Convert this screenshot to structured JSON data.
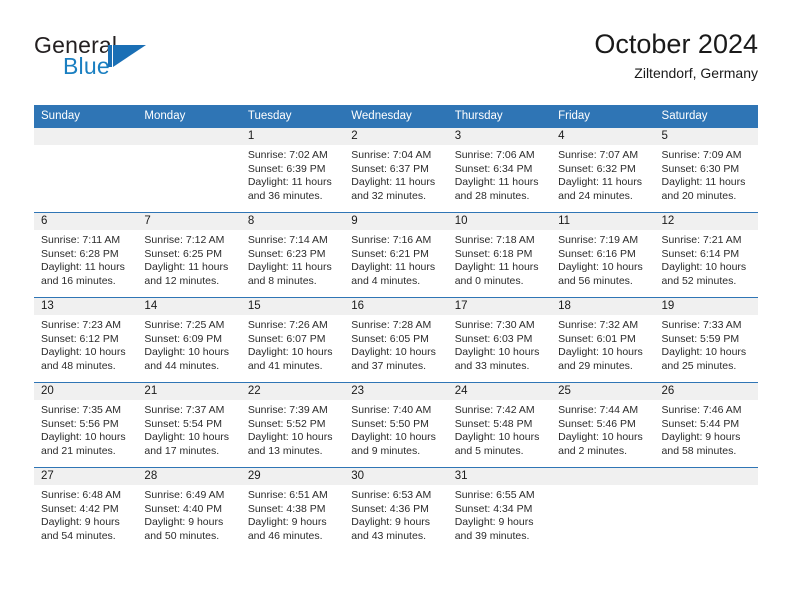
{
  "brand": {
    "name_part1": "General",
    "name_part2": "Blue",
    "accent_color": "#1a7fc1"
  },
  "header": {
    "title": "October 2024",
    "subtitle": "Ziltendorf, Germany"
  },
  "theme": {
    "header_blue": "#2f75b5",
    "daynum_band": "#f0f0f0",
    "text": "#1a1a1a"
  },
  "weekday_headers": [
    "Sunday",
    "Monday",
    "Tuesday",
    "Wednesday",
    "Thursday",
    "Friday",
    "Saturday"
  ],
  "weeks": [
    [
      {
        "day": "",
        "sunrise": "",
        "sunset": "",
        "daylight": ""
      },
      {
        "day": "",
        "sunrise": "",
        "sunset": "",
        "daylight": ""
      },
      {
        "day": "1",
        "sunrise": "Sunrise: 7:02 AM",
        "sunset": "Sunset: 6:39 PM",
        "daylight": "Daylight: 11 hours and 36 minutes."
      },
      {
        "day": "2",
        "sunrise": "Sunrise: 7:04 AM",
        "sunset": "Sunset: 6:37 PM",
        "daylight": "Daylight: 11 hours and 32 minutes."
      },
      {
        "day": "3",
        "sunrise": "Sunrise: 7:06 AM",
        "sunset": "Sunset: 6:34 PM",
        "daylight": "Daylight: 11 hours and 28 minutes."
      },
      {
        "day": "4",
        "sunrise": "Sunrise: 7:07 AM",
        "sunset": "Sunset: 6:32 PM",
        "daylight": "Daylight: 11 hours and 24 minutes."
      },
      {
        "day": "5",
        "sunrise": "Sunrise: 7:09 AM",
        "sunset": "Sunset: 6:30 PM",
        "daylight": "Daylight: 11 hours and 20 minutes."
      }
    ],
    [
      {
        "day": "6",
        "sunrise": "Sunrise: 7:11 AM",
        "sunset": "Sunset: 6:28 PM",
        "daylight": "Daylight: 11 hours and 16 minutes."
      },
      {
        "day": "7",
        "sunrise": "Sunrise: 7:12 AM",
        "sunset": "Sunset: 6:25 PM",
        "daylight": "Daylight: 11 hours and 12 minutes."
      },
      {
        "day": "8",
        "sunrise": "Sunrise: 7:14 AM",
        "sunset": "Sunset: 6:23 PM",
        "daylight": "Daylight: 11 hours and 8 minutes."
      },
      {
        "day": "9",
        "sunrise": "Sunrise: 7:16 AM",
        "sunset": "Sunset: 6:21 PM",
        "daylight": "Daylight: 11 hours and 4 minutes."
      },
      {
        "day": "10",
        "sunrise": "Sunrise: 7:18 AM",
        "sunset": "Sunset: 6:18 PM",
        "daylight": "Daylight: 11 hours and 0 minutes."
      },
      {
        "day": "11",
        "sunrise": "Sunrise: 7:19 AM",
        "sunset": "Sunset: 6:16 PM",
        "daylight": "Daylight: 10 hours and 56 minutes."
      },
      {
        "day": "12",
        "sunrise": "Sunrise: 7:21 AM",
        "sunset": "Sunset: 6:14 PM",
        "daylight": "Daylight: 10 hours and 52 minutes."
      }
    ],
    [
      {
        "day": "13",
        "sunrise": "Sunrise: 7:23 AM",
        "sunset": "Sunset: 6:12 PM",
        "daylight": "Daylight: 10 hours and 48 minutes."
      },
      {
        "day": "14",
        "sunrise": "Sunrise: 7:25 AM",
        "sunset": "Sunset: 6:09 PM",
        "daylight": "Daylight: 10 hours and 44 minutes."
      },
      {
        "day": "15",
        "sunrise": "Sunrise: 7:26 AM",
        "sunset": "Sunset: 6:07 PM",
        "daylight": "Daylight: 10 hours and 41 minutes."
      },
      {
        "day": "16",
        "sunrise": "Sunrise: 7:28 AM",
        "sunset": "Sunset: 6:05 PM",
        "daylight": "Daylight: 10 hours and 37 minutes."
      },
      {
        "day": "17",
        "sunrise": "Sunrise: 7:30 AM",
        "sunset": "Sunset: 6:03 PM",
        "daylight": "Daylight: 10 hours and 33 minutes."
      },
      {
        "day": "18",
        "sunrise": "Sunrise: 7:32 AM",
        "sunset": "Sunset: 6:01 PM",
        "daylight": "Daylight: 10 hours and 29 minutes."
      },
      {
        "day": "19",
        "sunrise": "Sunrise: 7:33 AM",
        "sunset": "Sunset: 5:59 PM",
        "daylight": "Daylight: 10 hours and 25 minutes."
      }
    ],
    [
      {
        "day": "20",
        "sunrise": "Sunrise: 7:35 AM",
        "sunset": "Sunset: 5:56 PM",
        "daylight": "Daylight: 10 hours and 21 minutes."
      },
      {
        "day": "21",
        "sunrise": "Sunrise: 7:37 AM",
        "sunset": "Sunset: 5:54 PM",
        "daylight": "Daylight: 10 hours and 17 minutes."
      },
      {
        "day": "22",
        "sunrise": "Sunrise: 7:39 AM",
        "sunset": "Sunset: 5:52 PM",
        "daylight": "Daylight: 10 hours and 13 minutes."
      },
      {
        "day": "23",
        "sunrise": "Sunrise: 7:40 AM",
        "sunset": "Sunset: 5:50 PM",
        "daylight": "Daylight: 10 hours and 9 minutes."
      },
      {
        "day": "24",
        "sunrise": "Sunrise: 7:42 AM",
        "sunset": "Sunset: 5:48 PM",
        "daylight": "Daylight: 10 hours and 5 minutes."
      },
      {
        "day": "25",
        "sunrise": "Sunrise: 7:44 AM",
        "sunset": "Sunset: 5:46 PM",
        "daylight": "Daylight: 10 hours and 2 minutes."
      },
      {
        "day": "26",
        "sunrise": "Sunrise: 7:46 AM",
        "sunset": "Sunset: 5:44 PM",
        "daylight": "Daylight: 9 hours and 58 minutes."
      }
    ],
    [
      {
        "day": "27",
        "sunrise": "Sunrise: 6:48 AM",
        "sunset": "Sunset: 4:42 PM",
        "daylight": "Daylight: 9 hours and 54 minutes."
      },
      {
        "day": "28",
        "sunrise": "Sunrise: 6:49 AM",
        "sunset": "Sunset: 4:40 PM",
        "daylight": "Daylight: 9 hours and 50 minutes."
      },
      {
        "day": "29",
        "sunrise": "Sunrise: 6:51 AM",
        "sunset": "Sunset: 4:38 PM",
        "daylight": "Daylight: 9 hours and 46 minutes."
      },
      {
        "day": "30",
        "sunrise": "Sunrise: 6:53 AM",
        "sunset": "Sunset: 4:36 PM",
        "daylight": "Daylight: 9 hours and 43 minutes."
      },
      {
        "day": "31",
        "sunrise": "Sunrise: 6:55 AM",
        "sunset": "Sunset: 4:34 PM",
        "daylight": "Daylight: 9 hours and 39 minutes."
      },
      {
        "day": "",
        "sunrise": "",
        "sunset": "",
        "daylight": ""
      },
      {
        "day": "",
        "sunrise": "",
        "sunset": "",
        "daylight": ""
      }
    ]
  ]
}
